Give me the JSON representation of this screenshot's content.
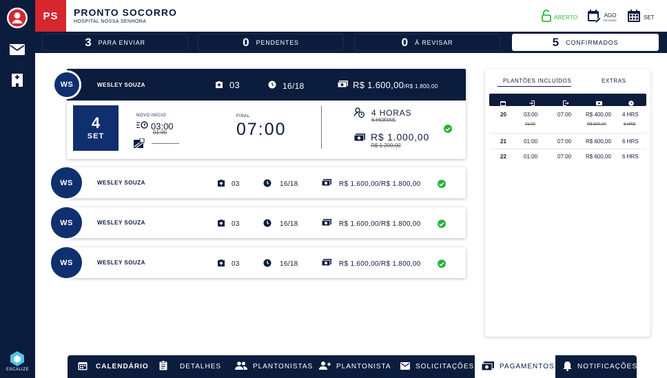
{
  "sidebar": {
    "logo_text": "ESCALIZE"
  },
  "header": {
    "badge": "PS",
    "title": "PRONTO SOCORRO",
    "subtitle": "HOSPITAL NOSSA SENHORA",
    "status_label": "ABERTO",
    "prev_month": "AGO",
    "prev_month_sub": "REVISAR",
    "next_month": "SET",
    "accent_green": "#2bbd3f",
    "brand_red": "#d7262e",
    "navy": "#0b1c3d"
  },
  "stats": [
    {
      "num": "3",
      "label": "PARA ENVIAR"
    },
    {
      "num": "0",
      "label": "PENDENTES"
    },
    {
      "num": "0",
      "label": "À REVISAR"
    },
    {
      "num": "5",
      "label": "CONFIRMADOS"
    }
  ],
  "expanded": {
    "avatar": "WS",
    "name": "WESLEY SOUZA",
    "shifts": "03",
    "days": "16/18",
    "value": "R$ 1.600,00",
    "value_max": "/R$ 1.800,00",
    "day": "4",
    "month": "SET",
    "new_start_label": "NOVO INÍCIO",
    "new_start": "03:00",
    "old_start": "01:00",
    "dashes": "----------------",
    "final_label": "FINAL",
    "final": "07:00",
    "hours": "4 HORAS",
    "old_hours": "6 HORAS",
    "pay": "R$ 1.000,00",
    "old_pay": "R$ 1.200,00"
  },
  "rows": [
    {
      "avatar": "WS",
      "name": "WESLEY SOUZA",
      "shifts": "03",
      "days": "16/18",
      "value": "R$ 1.600,00/R$ 1.800,00"
    },
    {
      "avatar": "WS",
      "name": "WESLEY SOUZA",
      "shifts": "03",
      "days": "16/18",
      "value": "R$ 1.600,00/R$ 1.800,00"
    },
    {
      "avatar": "WS",
      "name": "WESLEY SOUZA",
      "shifts": "03",
      "days": "16/18",
      "value": "R$ 1.600,00/R$ 1.800,00"
    }
  ],
  "panel": {
    "tab_included": "PLANTÕES INCLUÍDOS",
    "tab_extras": "EXTRAS",
    "rows": [
      {
        "day": "20",
        "in": "03:00",
        "in_old": "01:00",
        "out": "07:00",
        "pay": "R$ 400,00",
        "pay_old": "R$ 600,00",
        "hours": "4 HRS",
        "hours_old": "6 HRS"
      },
      {
        "day": "21",
        "in": "01:00",
        "out": "07:00",
        "pay": "R$ 600,00",
        "hours": "6 HRS"
      },
      {
        "day": "22",
        "in": "01:00",
        "out": "07:00",
        "pay": "R$ 600,00",
        "hours": "6 HRS"
      }
    ]
  },
  "bottom_nav": [
    {
      "label": "CALENDÁRIO",
      "icon": "calendar-icon"
    },
    {
      "label": "DETALHES",
      "icon": "clipboard-icon"
    },
    {
      "label": "PLANTONISTAS",
      "icon": "people-icon"
    },
    {
      "label": "PLANTONISTA",
      "icon": "person-add-icon"
    },
    {
      "label": "SOLICITAÇÕES",
      "icon": "mail-icon"
    },
    {
      "label": "PAGAMENTOS",
      "icon": "money-icon"
    },
    {
      "label": "NOTIFICAÇÕES",
      "icon": "bell-icon"
    }
  ]
}
